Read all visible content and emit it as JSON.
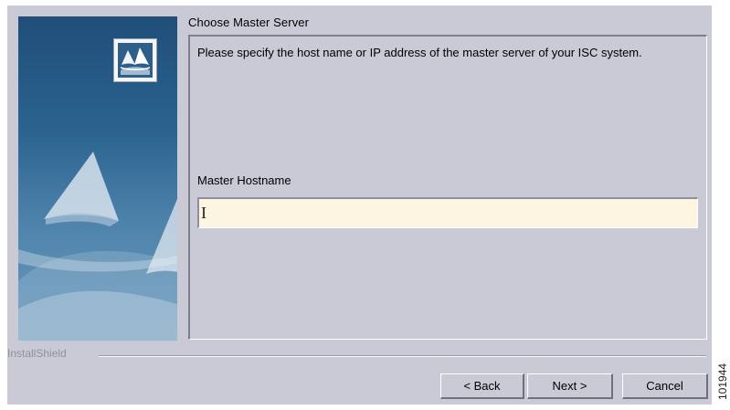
{
  "dialog": {
    "page_title": "Choose Master Server",
    "instructions": "Please specify the host name or IP address of the master server of your ISC system.",
    "field_label": "Master Hostname",
    "hostname_value": "",
    "brand_label": "InstallShield"
  },
  "buttons": {
    "back": "< Back",
    "next": "Next >",
    "cancel": "Cancel"
  },
  "figure_id": "101944",
  "colors": {
    "window_bg": "#c9cad6",
    "input_bg": "#fdf5e2",
    "banner_top": "#1f4e78",
    "banner_bottom": "#6e9bbd"
  },
  "icons": {
    "banner_logo": "installer-sail-logo-icon",
    "text_cursor": "i-beam-cursor-icon"
  }
}
